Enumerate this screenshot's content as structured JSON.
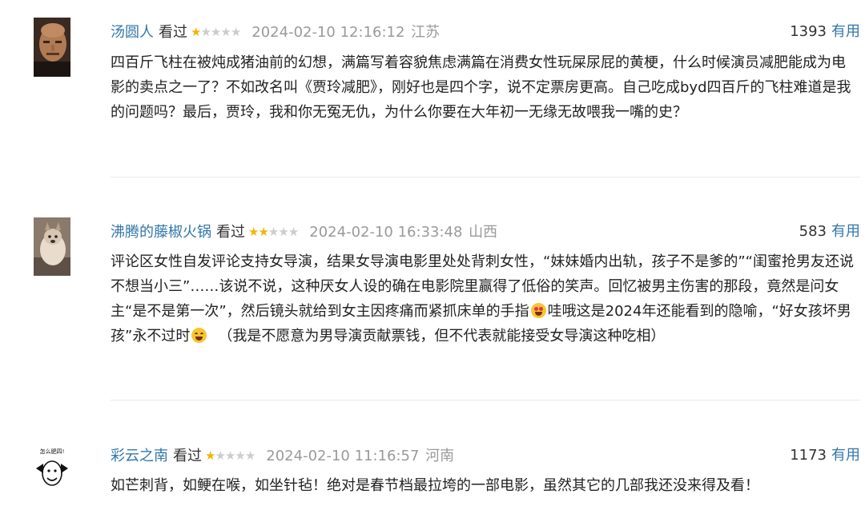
{
  "reviews": [
    {
      "username": "汤圆人",
      "status": "看过",
      "rating": 1,
      "max_rating": 5,
      "date": "2024-02-10 12:16:12",
      "location": "江苏",
      "votes": "1393",
      "useful_label": "有用",
      "avatar_icon": "bald-man-avatar",
      "text": "四百斤飞柱在被炖成猪油前的幻想，满篇写着容貌焦虑满篇在消费女性玩屎尿屁的黄梗，什么时候演员减肥能成为电影的卖点之一了？不如改名叫《贾玲减肥》，刚好也是四个字，说不定票房更高。自己吃成byd四百斤的飞柱难道是我的问题吗？最后，贾玲，我和你无冤无仇，为什么你要在大年初一无缘无故喂我一嘴的史？"
    },
    {
      "username": "沸腾的藤椒火锅",
      "status": "看过",
      "rating": 2,
      "max_rating": 5,
      "date": "2024-02-10 16:33:48",
      "location": "山西",
      "votes": "583",
      "useful_label": "有用",
      "avatar_icon": "dog-avatar",
      "text_part1": "评论区女性自发评论支持女导演，结果女导演电影里处处背刺女性，“妹妹婚内出轨，孩子不是爹的”“闺蜜抢男友还说不想当小三”……该说不说，这种厌女人设的确在电影院里赢得了低俗的笑声。回忆被男主伤害的那段，竟然是问女主“是不是第一次”，然后镜头就给到女主因疼痛而紧抓床单的手指",
      "text_part2": "哇哦这是2024年还能看到的隐喻，“好女孩坏男孩”永不过时",
      "text_part3": "（我是不愿意为男导演贡献票钱，但不代表就能接受女导演这种吃相）",
      "emoji1": "heart-eyes-emoji",
      "emoji2": "grin-emoji"
    },
    {
      "username": "彩云之南",
      "status": "看过",
      "rating": 1,
      "max_rating": 5,
      "date": "2024-02-10 11:16:57",
      "location": "河南",
      "votes": "1173",
      "useful_label": "有用",
      "avatar_icon": "cartoon-meme-avatar",
      "avatar_caption": "怎么肥四!",
      "text": "如芒刺背，如鲠在喉，如坐针毡！绝对是春节档最拉垮的一部电影，虽然其它的几部我还没来得及看！"
    }
  ],
  "colors": {
    "link": "#3377aa",
    "star_on": "#f4b400",
    "star_off": "#cccccc",
    "meta": "#9a9a9a"
  }
}
